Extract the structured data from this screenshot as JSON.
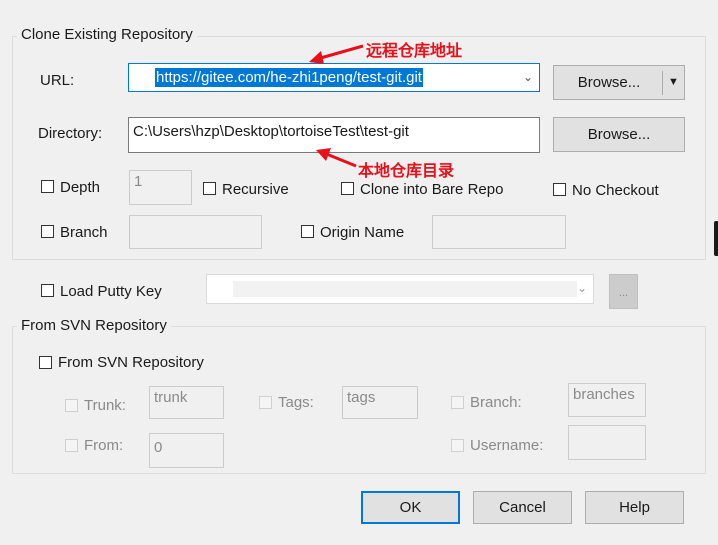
{
  "clone_group": {
    "title": "Clone Existing Repository",
    "url_label": "URL:",
    "url_value": "https://gitee.com/he-zhi1peng/test-git.git",
    "directory_label": "Directory:",
    "directory_value": "C:\\Users\\hzp\\Desktop\\tortoiseTest\\test-git",
    "browse_label_1": "Browse...",
    "browse_label_2": "Browse...",
    "depth_label": "Depth",
    "depth_value": "1",
    "recursive_label": "Recursive",
    "clone_bare_label": "Clone into Bare Repo",
    "no_checkout_label": "No Checkout",
    "branch_label": "Branch",
    "origin_name_label": "Origin Name"
  },
  "putty": {
    "label": "Load Putty Key",
    "browse_label": "..."
  },
  "svn_group": {
    "title": "From SVN Repository",
    "checkbox_label": "From SVN Repository",
    "trunk_label": "Trunk:",
    "trunk_value": "trunk",
    "tags_label": "Tags:",
    "tags_value": "tags",
    "branch_label": "Branch:",
    "branch_value": "branches",
    "from_label": "From:",
    "from_value": "0",
    "username_label": "Username:"
  },
  "buttons": {
    "ok": "OK",
    "cancel": "Cancel",
    "help": "Help"
  },
  "annotations": {
    "remote": "远程仓库地址",
    "local": "本地仓库目录",
    "color": "#e8101b"
  },
  "colors": {
    "accent": "#0078d7"
  }
}
